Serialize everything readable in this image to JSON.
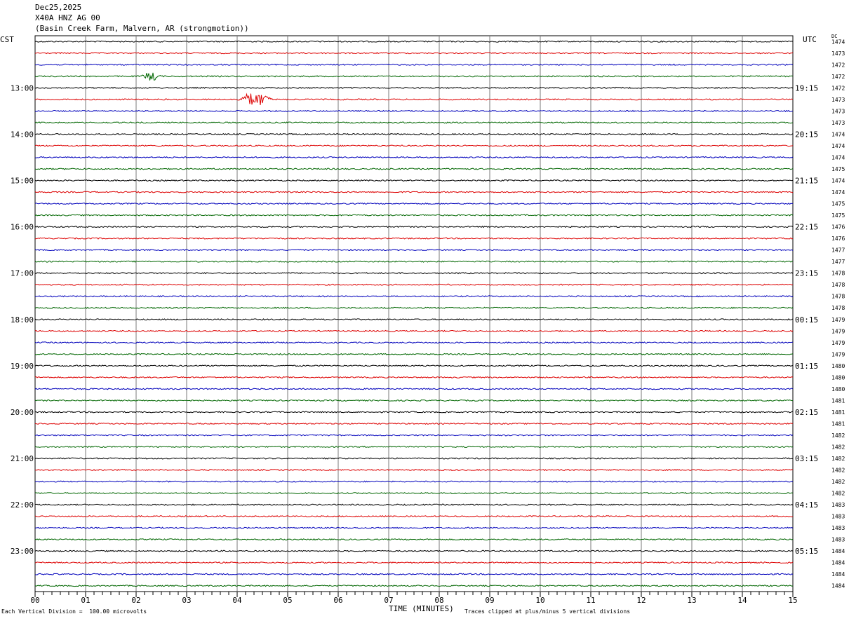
{
  "header": {
    "date": "Dec25,2025",
    "station": "X40A HNZ AG 00",
    "location": "(Basin Creek Farm, Malvern, AR (strongmotion))"
  },
  "left_zone_label": "CST",
  "right_zone_label": "UTC",
  "dc_label": "DC",
  "footer": {
    "scale_note": "Each Vertical Division =  100.00 microvolts",
    "x_title": "TIME (MINUTES)",
    "clip_note": "Traces clipped at plus/minus 5 vertical divisions"
  },
  "colors": {
    "trace_cycle": [
      "#000000",
      "#dd0000",
      "#0000bb",
      "#006600"
    ],
    "grid": "#7a7a7a"
  },
  "chart_data": {
    "type": "line",
    "title": "X40A HNZ AG 00",
    "xlabel": "TIME (MINUTES)",
    "xlim": [
      0,
      15
    ],
    "x_ticks": [
      "00",
      "01",
      "02",
      "03",
      "04",
      "05",
      "06",
      "07",
      "08",
      "09",
      "10",
      "11",
      "12",
      "13",
      "14",
      "15"
    ],
    "rows_per_hour": 4,
    "row_count": 48,
    "left_hour_labels": [
      {
        "row": 4,
        "text": "13:00"
      },
      {
        "row": 8,
        "text": "14:00"
      },
      {
        "row": 12,
        "text": "15:00"
      },
      {
        "row": 16,
        "text": "16:00"
      },
      {
        "row": 20,
        "text": "17:00"
      },
      {
        "row": 24,
        "text": "18:00"
      },
      {
        "row": 28,
        "text": "19:00"
      },
      {
        "row": 32,
        "text": "20:00"
      },
      {
        "row": 36,
        "text": "21:00"
      },
      {
        "row": 40,
        "text": "22:00"
      },
      {
        "row": 44,
        "text": "23:00"
      }
    ],
    "right_hour_labels": [
      {
        "row": 4,
        "text": "19:15"
      },
      {
        "row": 8,
        "text": "20:15"
      },
      {
        "row": 12,
        "text": "21:15"
      },
      {
        "row": 16,
        "text": "22:15"
      },
      {
        "row": 20,
        "text": "23:15"
      },
      {
        "row": 24,
        "text": "00:15"
      },
      {
        "row": 28,
        "text": "01:15"
      },
      {
        "row": 32,
        "text": "02:15"
      },
      {
        "row": 36,
        "text": "03:15"
      },
      {
        "row": 40,
        "text": "04:15"
      },
      {
        "row": 44,
        "text": "05:15"
      }
    ],
    "dc_values": [
      "1474",
      "1473",
      "1472",
      "1472",
      "1472",
      "1473",
      "1473",
      "1473",
      "1474",
      "1474",
      "1474",
      "1475",
      "1474",
      "1474",
      "1475",
      "1475",
      "1476",
      "1476",
      "1477",
      "1477",
      "1478",
      "1478",
      "1478",
      "1478",
      "1479",
      "1479",
      "1479",
      "1479",
      "1480",
      "1480",
      "1480",
      "1481",
      "1481",
      "1481",
      "1482",
      "1482",
      "1482",
      "1482",
      "1482",
      "1482",
      "1483",
      "1483",
      "1483",
      "1483",
      "1484",
      "1484",
      "1484",
      "1484"
    ],
    "events": [
      {
        "row": 3,
        "start_min": 2.1,
        "end_min": 2.5,
        "amplitude_div": 1.5
      },
      {
        "row": 5,
        "start_min": 4.0,
        "end_min": 4.7,
        "amplitude_div": 2.5
      }
    ],
    "clip_divisions": 5,
    "microvolts_per_division": 100
  }
}
